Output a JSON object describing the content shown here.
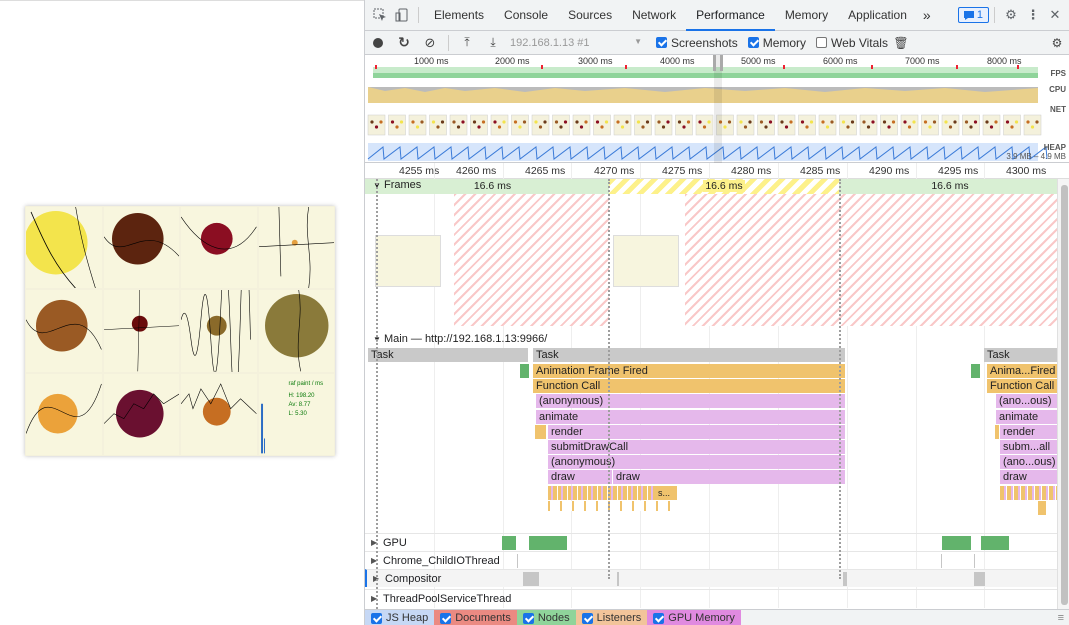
{
  "devtools": {
    "tabs": [
      "Elements",
      "Console",
      "Sources",
      "Network",
      "Performance",
      "Memory",
      "Application"
    ],
    "active_tab": "Performance",
    "more_tabs": "»",
    "issues_count": "1"
  },
  "toolbar": {
    "profile_select": "192.168.1.13 #1",
    "screenshots_label": "Screenshots",
    "memory_label": "Memory",
    "web_vitals_label": "Web Vitals"
  },
  "overview": {
    "ticks": [
      "1000 ms",
      "2000 ms",
      "3000 ms",
      "4000 ms",
      "5000 ms",
      "6000 ms",
      "7000 ms",
      "8000 ms"
    ],
    "labels": {
      "fps": "FPS",
      "cpu": "CPU",
      "net": "NET",
      "heap": "HEAP",
      "heap_range": "3.9 MB – 4.9 MB"
    }
  },
  "ruler": {
    "ticks": [
      "4255 ms",
      "4260 ms",
      "4265 ms",
      "4270 ms",
      "4275 ms",
      "4280 ms",
      "4285 ms",
      "4290 ms",
      "4295 ms",
      "4300 ms"
    ]
  },
  "frames": {
    "title": "Frames",
    "durations": [
      "16.6 ms",
      "16.6 ms",
      "16.6 ms"
    ]
  },
  "main": {
    "title": "Main — http://192.168.1.13:9966/",
    "task_label": "Task",
    "flame": {
      "animation_frame": "Animation Frame Fired",
      "function_call": "Function Call",
      "anonymous": "(anonymous)",
      "animate": "animate",
      "render": "render",
      "submit": "submitDrawCall",
      "draw": "draw",
      "s_short": "s...",
      "anim_short": "Anima...Fired",
      "anon_short": "(ano...ous)",
      "submit_short": "subm...all"
    }
  },
  "threads": [
    "GPU",
    "Chrome_ChildIOThread",
    "Compositor",
    "ThreadPoolServiceThread"
  ],
  "bottom_tabs": [
    "JS Heap",
    "Documents",
    "Nodes",
    "Listeners",
    "GPU Memory"
  ],
  "canvas": {
    "stats": {
      "title": "raf paint / ms",
      "h": "H: 198.20",
      "av": "Av: 8.77",
      "l": "L: 5.30"
    }
  }
}
